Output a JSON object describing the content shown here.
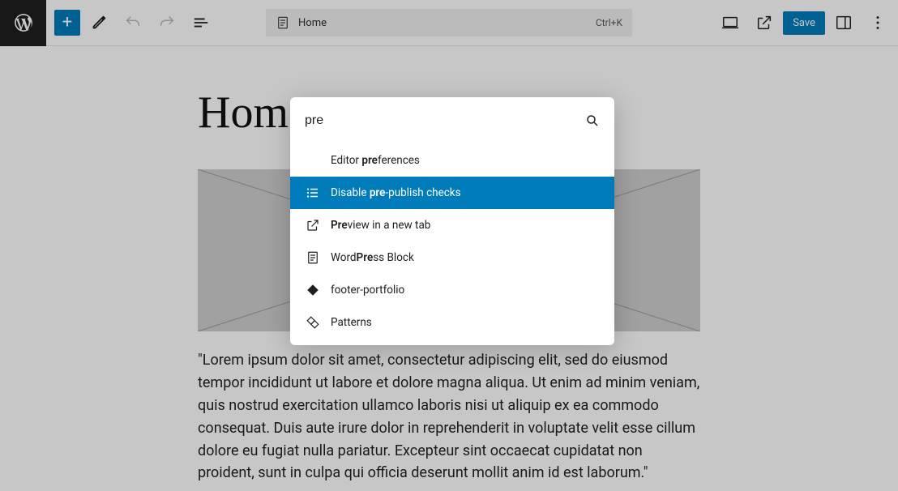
{
  "toolbar": {
    "doc_name": "Home",
    "shortcut": "Ctrl+K",
    "save_label": "Save"
  },
  "page": {
    "title": "Home",
    "paragraph": "\"Lorem ipsum dolor sit amet, consectetur adipiscing elit, sed do eiusmod tempor incididunt ut labore et dolore magna aliqua. Ut enim ad minim veniam, quis nostrud exercitation ullamco laboris nisi ut aliquip ex ea commodo consequat. Duis aute irure dolor in reprehenderit in voluptate velit esse cillum dolore eu fugiat nulla pariatur. Excepteur sint occaecat cupidatat non proident, sunt in culpa qui officia deserunt mollit anim id est laborum.\""
  },
  "palette": {
    "query": "pre",
    "items": [
      {
        "label_prefix": "Editor ",
        "label_match": "pre",
        "label_suffix": "ferences",
        "icon": "",
        "selected": false
      },
      {
        "label_prefix": "Disable ",
        "label_match": "pre",
        "label_suffix": "-publish checks",
        "icon": "list",
        "selected": true
      },
      {
        "label_prefix": "",
        "label_match": "Pre",
        "label_suffix": "view in a new tab",
        "icon": "external",
        "selected": false
      },
      {
        "label_prefix": "Word",
        "label_match": "Pre",
        "label_suffix": "ss Block",
        "icon": "doc",
        "selected": false
      },
      {
        "label_prefix": "footer-portfolio",
        "label_match": "",
        "label_suffix": "",
        "icon": "diamond",
        "selected": false
      },
      {
        "label_prefix": "Patterns",
        "label_match": "",
        "label_suffix": "",
        "icon": "diamonds",
        "selected": false
      }
    ]
  }
}
